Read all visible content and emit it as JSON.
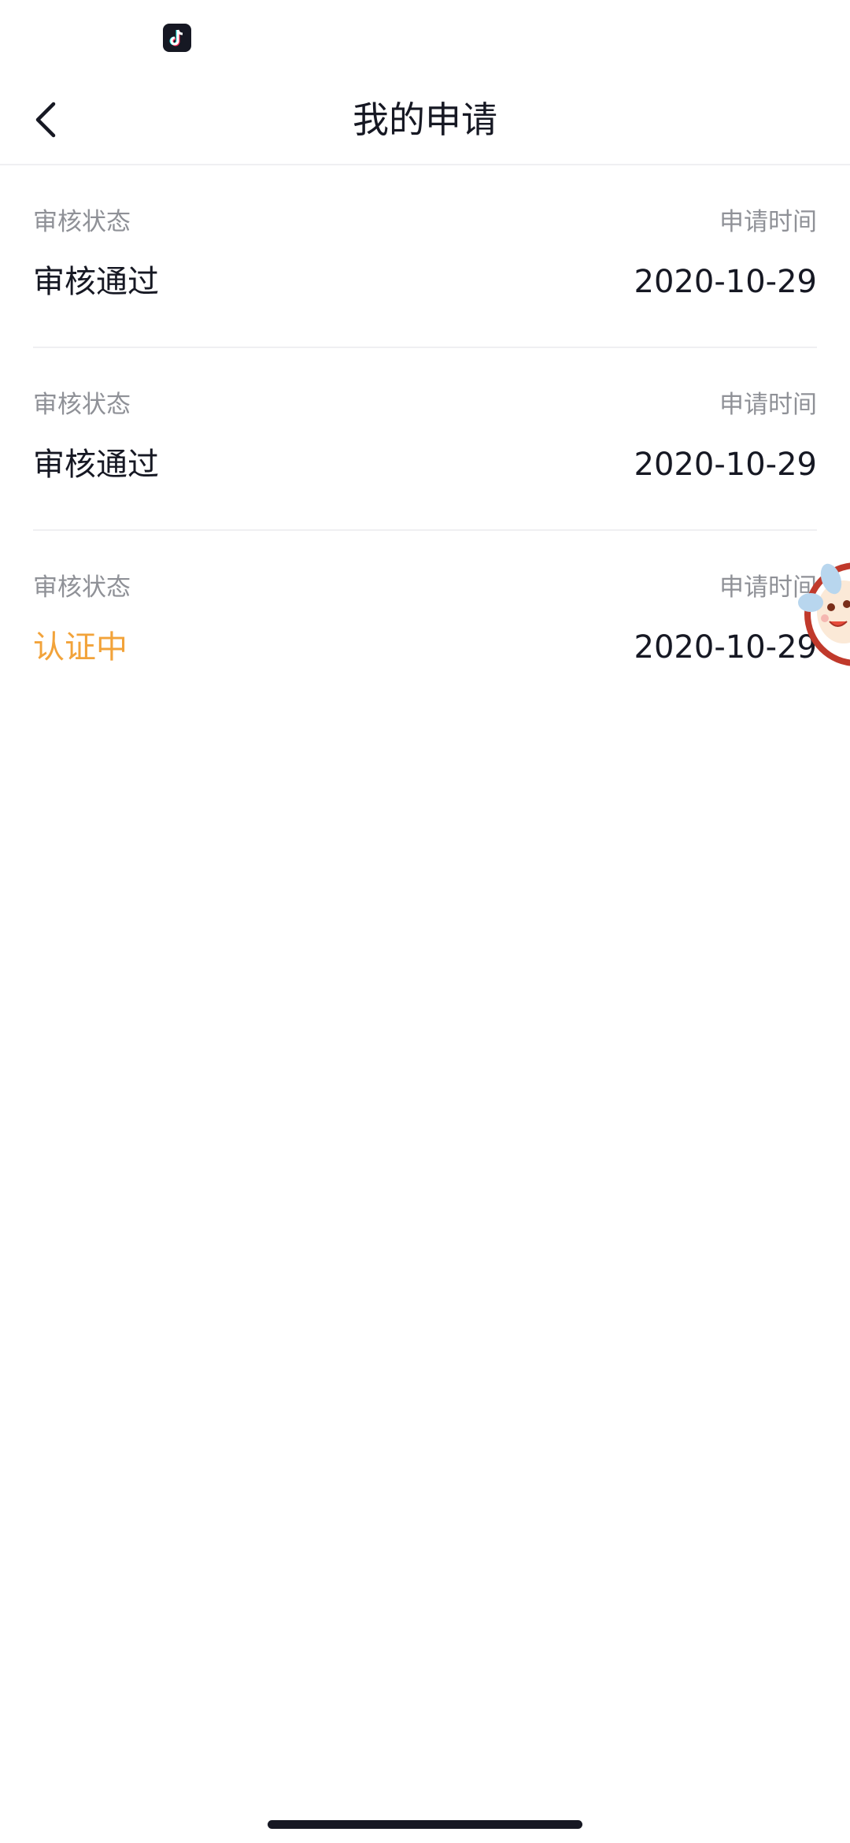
{
  "status_bar": {
    "app_icon": "tiktok-icon"
  },
  "nav": {
    "back_icon": "chevron-left-icon",
    "title": "我的申请"
  },
  "records": [
    {
      "status_label": "审核状态",
      "status_value": "审核通过",
      "time_label": "申请时间",
      "time_value": "2020-10-29"
    },
    {
      "status_label": "审核状态",
      "status_value": "审核通过",
      "time_label": "申请时间",
      "time_value": "2020-10-29"
    },
    {
      "status_label": "审核状态",
      "status_value": "认证中",
      "time_label": "申请时间",
      "time_value": "2020-10-29"
    }
  ],
  "colors": {
    "title_text": "#161823",
    "label_text": "#8f9197",
    "pending_status": "#f2a33a",
    "divider": "#efeff2"
  },
  "floating_widget": {
    "icon": "mascot-icon"
  }
}
